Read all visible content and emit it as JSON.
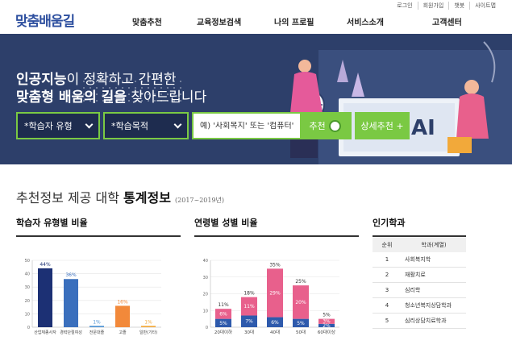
{
  "header": {
    "logo": "맞춤배움길",
    "util": [
      "로그인",
      "회원가입",
      "챗봇",
      "사이트맵"
    ],
    "nav": [
      "맞춤추천",
      "교육정보검색",
      "나의 프로필",
      "서비스소개",
      "고객센터"
    ]
  },
  "hero": {
    "line1_bold": "인공지능",
    "line1_rest": "이 정확하고 간편한",
    "line2_bold": "맞춤형 배움의 길을",
    "line2_rest": " 찾아드립니다",
    "select_type": "*학습자 유형",
    "select_purpose": "*학습목적",
    "search_placeholder": "예) '사회복지' 또는 '컴퓨터'",
    "recommend_label": "추천",
    "detail_label": "상세추천 +"
  },
  "section": {
    "title_light": "추천정보 제공 대학 ",
    "title_bold": "통계정보",
    "period": "(2017~2019년)"
  },
  "panels": {
    "learner": "학습자 유형별 비율",
    "age_gender": "연령별 성별 비율",
    "popular": "인기학과"
  },
  "chart_data": [
    {
      "type": "bar",
      "title": "학습자 유형별 비율",
      "categories": [
        "산업체종사자",
        "경력단절여성",
        "전문대졸",
        "고졸",
        "일반(기타)"
      ],
      "values": [
        44,
        36,
        1,
        16,
        1
      ],
      "value_labels": [
        "44%",
        "36%",
        "1%",
        "16%",
        "1%"
      ],
      "colors": [
        "#1c3074",
        "#3a6fbd",
        "#4e93d4",
        "#f2893a",
        "#f2a93a"
      ],
      "yticks": [
        0,
        10,
        20,
        30,
        40,
        50
      ],
      "ylim": [
        0,
        50
      ]
    },
    {
      "type": "bar",
      "title": "연령별 성별 비율",
      "categories": [
        "20대이하",
        "30대",
        "40대",
        "50대",
        "60대이상"
      ],
      "series": [
        {
          "values": [
            5,
            7,
            6,
            5,
            2
          ],
          "labels": [
            "5%",
            "7%",
            "6%",
            "5%",
            "2%"
          ],
          "color": "#2e5aac"
        },
        {
          "values": [
            6,
            11,
            29,
            20,
            3
          ],
          "labels": [
            "6%",
            "11%",
            "29%",
            "20%",
            "3%"
          ],
          "color": "#e8608c"
        }
      ],
      "totals": [
        "11%",
        "18%",
        "35%",
        "25%",
        "5%"
      ],
      "total_values": [
        11,
        18,
        35,
        25,
        5
      ],
      "yticks": [
        0,
        10,
        20,
        30,
        40
      ],
      "ylim": [
        0,
        40
      ]
    }
  ],
  "popular": {
    "headers": [
      "순위",
      "학과(계열)"
    ],
    "rows": [
      {
        "rank": "1",
        "name": "사회복지학"
      },
      {
        "rank": "2",
        "name": "재활치료"
      },
      {
        "rank": "3",
        "name": "심리학"
      },
      {
        "rank": "4",
        "name": "청소년복지상담학과"
      },
      {
        "rank": "5",
        "name": "심리상담치료학과"
      }
    ]
  },
  "colors": {
    "brand": "#2d4f9f",
    "hero_bg": "#2d3f6a",
    "accent_green": "#7ac943"
  }
}
